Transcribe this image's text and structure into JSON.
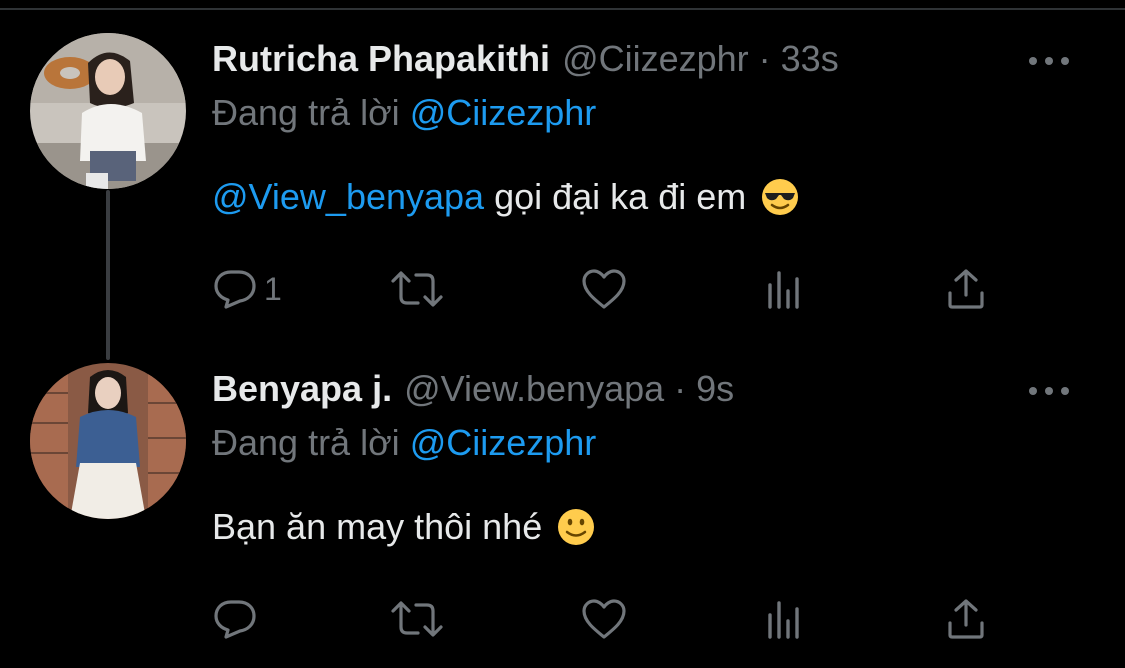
{
  "colors": {
    "background": "#000000",
    "primary_text": "#e7e9ea",
    "secondary_text": "#71767b",
    "accent": "#1d9bf0",
    "thread_line": "#3a3d41"
  },
  "tweets": [
    {
      "display_name": "Rutricha Phapakithi",
      "handle": "@Ciizezphr",
      "separator": "·",
      "time": "33s",
      "replying_prefix": "Đang trả lời",
      "replying_to": "@Ciizezphr",
      "body_mention": "@View_benyapa",
      "body_text": " gọi đại ka đi em",
      "emoji": "smiling-face-with-sunglasses",
      "reply_count": "1",
      "icons": [
        "reply-icon",
        "retweet-icon",
        "like-icon",
        "analytics-icon",
        "share-icon"
      ]
    },
    {
      "display_name": "Benyapa j.",
      "handle": "@View.benyapa",
      "separator": "·",
      "time": "9s",
      "replying_prefix": "Đang trả lời",
      "replying_to": "@Ciizezphr",
      "body_text": "Bạn ăn may thôi nhé",
      "emoji": "slightly-smiling-face",
      "reply_count": "",
      "icons": [
        "reply-icon",
        "retweet-icon",
        "like-icon",
        "analytics-icon",
        "share-icon"
      ]
    }
  ]
}
